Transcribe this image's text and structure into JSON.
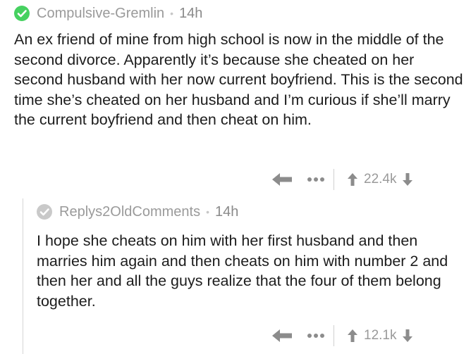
{
  "comments": [
    {
      "username": "Compulsive-Gremlin",
      "separator": "•",
      "timestamp": "14h",
      "body": "An ex friend of mine from high school is now in the middle of the second divorce. Apparently it’s because she cheated on her second husband with her now current boyfriend. This is the second time she’s cheated on her husband and I’m curious if she’ll marry the current boyfriend and then cheat on him.",
      "score": "22.4k",
      "more_label": "•••",
      "badge_color": "#46d160"
    },
    {
      "username": "Replys2OldComments",
      "separator": "•",
      "timestamp": "14h",
      "body": "I hope she cheats on him with her first husband and then marries him again and then cheats on him with number 2 and then her and all the guys realize that the four of them belong together.",
      "score": "12.1k",
      "more_label": "•••",
      "badge_color": "#c9c9c9"
    }
  ],
  "icons": {
    "badge": "check-circle-icon",
    "reply": "reply-arrow-icon",
    "more": "more-dots-icon",
    "upvote": "upvote-arrow-icon",
    "downvote": "downvote-arrow-icon"
  },
  "colors": {
    "text": "#1c1c1c",
    "meta": "#9a9a9a",
    "icon": "#8c8c8c",
    "thread_line": "#d6d6d6"
  }
}
